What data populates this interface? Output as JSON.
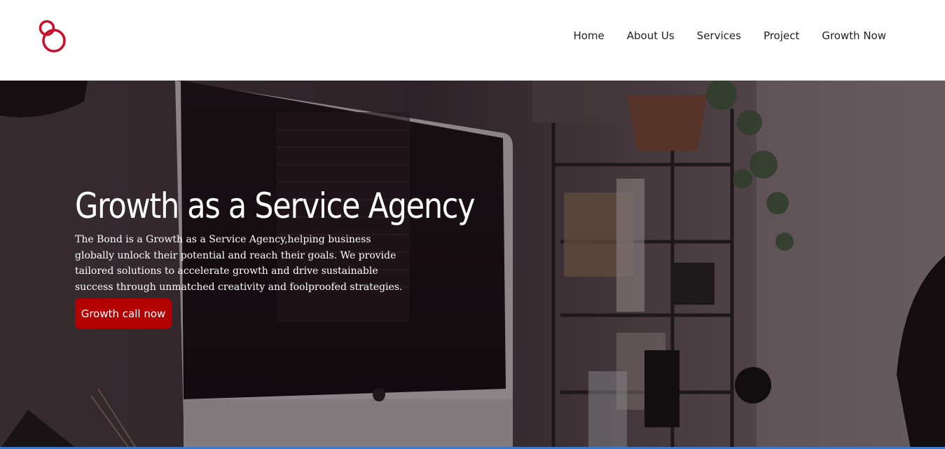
{
  "brand": {
    "logo_icon": "interlocking-rings-logo",
    "accent_color": "#c8102e"
  },
  "nav": {
    "items": [
      {
        "label": "Home"
      },
      {
        "label": "About Us"
      },
      {
        "label": "Services"
      },
      {
        "label": "Project"
      },
      {
        "label": "Growth Now"
      }
    ]
  },
  "hero": {
    "title": "Growth as a Service Agency",
    "description": "The Bond is a Growth as a Service Agency,helping business globally unlock their potential and reach their goals. We provide tailored solutions to accelerate growth and drive sustainable success through unmatched creativity and foolproofed strategies.",
    "cta_label": "Growth call now",
    "cta_color": "#b30000",
    "background_image": "desk-with-imac-and-shelves-photo"
  }
}
